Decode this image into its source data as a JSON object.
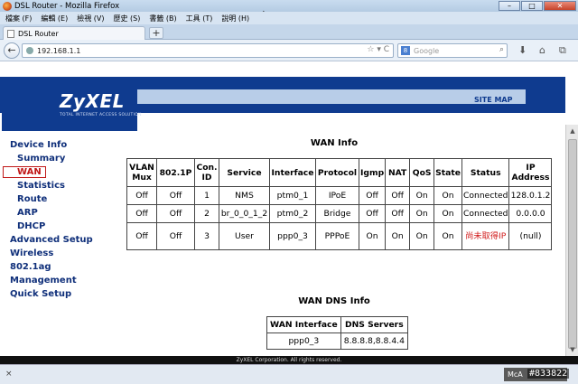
{
  "window": {
    "title": "DSL Router - Mozilla Firefox"
  },
  "menubar": [
    "檔案 (F)",
    "編輯 (E)",
    "檢視 (V)",
    "歷史 (S)",
    "書籤 (B)",
    "工具 (T)",
    "說明 (H)"
  ],
  "tab": {
    "label": "DSL Router",
    "new_tab": "+"
  },
  "navbar": {
    "url": "192.168.1.1",
    "search_placeholder": "Google",
    "search_engine_icon": "8"
  },
  "router": {
    "logo": "ZyXEL",
    "logo_tagline": "TOTAL INTERNET ACCESS SOLUTION",
    "site_map": "SITE MAP"
  },
  "sidebar": [
    {
      "label": "Device Info",
      "level": "top"
    },
    {
      "label": "Summary",
      "level": "sub"
    },
    {
      "label": "WAN",
      "level": "sub",
      "active": true
    },
    {
      "label": "Statistics",
      "level": "sub"
    },
    {
      "label": "Route",
      "level": "sub"
    },
    {
      "label": "ARP",
      "level": "sub"
    },
    {
      "label": "DHCP",
      "level": "sub"
    },
    {
      "label": "Advanced Setup",
      "level": "top"
    },
    {
      "label": "Wireless",
      "level": "top"
    },
    {
      "label": "802.1ag",
      "level": "top"
    },
    {
      "label": "Management",
      "level": "top"
    },
    {
      "label": "Quick Setup",
      "level": "top"
    }
  ],
  "wan_info": {
    "title": "WAN Info",
    "headers": [
      "VLAN Mux",
      "802.1P",
      "Con. ID",
      "Service",
      "Interface",
      "Protocol",
      "Igmp",
      "NAT",
      "QoS",
      "State",
      "Status",
      "IP Address"
    ],
    "rows": [
      [
        "Off",
        "Off",
        "1",
        "NMS",
        "ptm0_1",
        "IPoE",
        "Off",
        "Off",
        "On",
        "On",
        "Connected",
        "128.0.1.2"
      ],
      [
        "Off",
        "Off",
        "2",
        "br_0_0_1_2",
        "ptm0_2",
        "Bridge",
        "Off",
        "Off",
        "On",
        "On",
        "Connected",
        "0.0.0.0"
      ],
      [
        "Off",
        "Off",
        "3",
        "User",
        "ppp0_3",
        "PPPoE",
        "On",
        "On",
        "On",
        "On",
        "尚未取得IP",
        "(null)"
      ]
    ]
  },
  "wan_dns_info": {
    "title": "WAN DNS Info",
    "headers": [
      "WAN Interface",
      "DNS Servers"
    ],
    "rows": [
      [
        "ppp0_3",
        "8.8.8.8,8.8.4.4"
      ]
    ]
  },
  "footer": "ZyXEL Corporation. All rights reserved.",
  "status": {
    "close": "×",
    "addon": "McA"
  },
  "watermark": "#833822",
  "colors": {
    "brand_blue": "#0f3b8f",
    "nav_text": "#0f2f7a",
    "active_red": "#c01818"
  }
}
